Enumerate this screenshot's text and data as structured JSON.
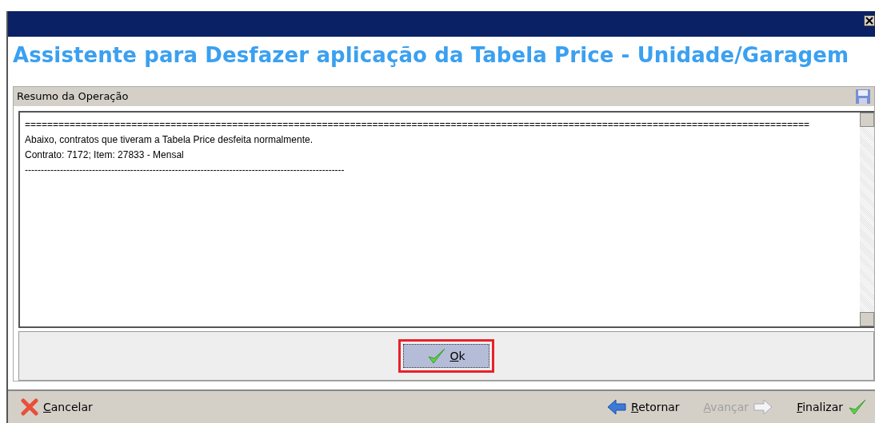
{
  "heading": "Assistente para Desfazer aplicação da Tabela Price - Unidade/Garagem",
  "panel": {
    "title": "Resumo da Operação",
    "lines": [
      "============================================================================================================================================",
      "Abaixo, contratos que tiveram a Tabela Price desfeita normalmente.",
      "Contrato: 7172; Item: 27833 - Mensal",
      "----------------------------------------------------------------------------------------------------"
    ]
  },
  "ok_button": {
    "label": "Ok",
    "highlighted": true
  },
  "footer": [
    {
      "kind": "cancel",
      "label": "Cancelar",
      "disabled": false
    },
    {
      "kind": "back",
      "label": "Retornar",
      "disabled": false
    },
    {
      "kind": "next",
      "label": "Avançar",
      "disabled": true
    },
    {
      "kind": "finish",
      "label": "Finalizar",
      "disabled": false
    }
  ]
}
